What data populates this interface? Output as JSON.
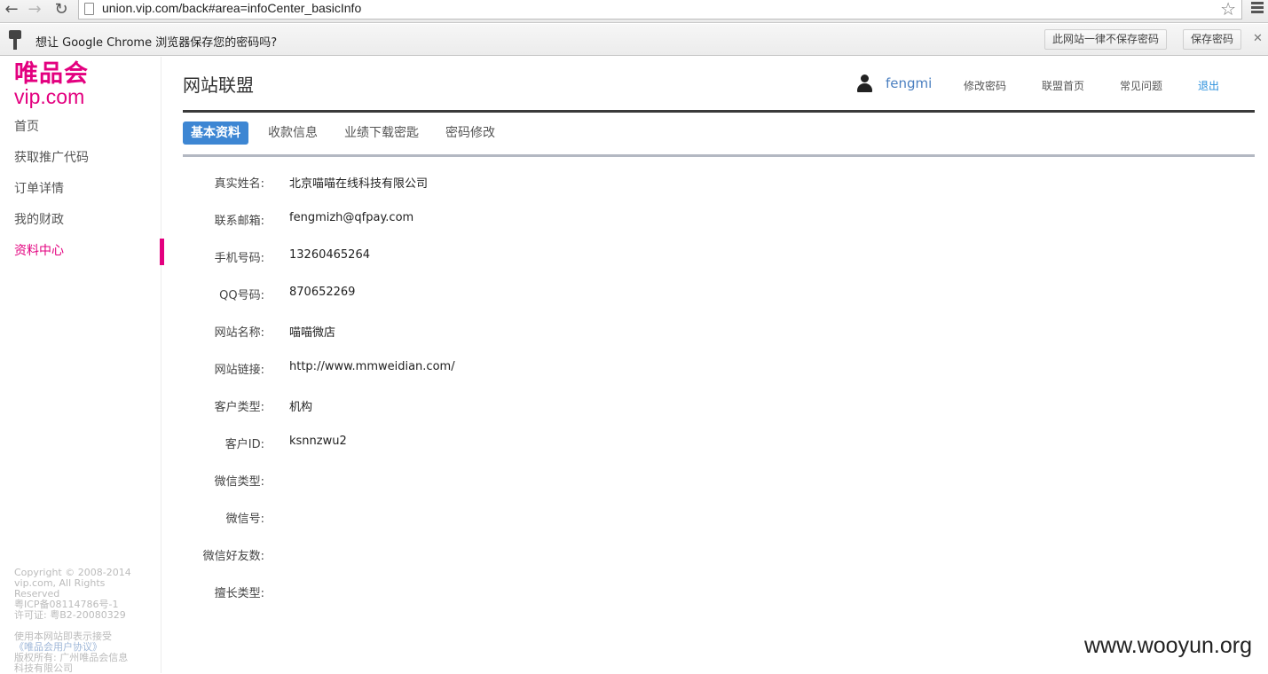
{
  "browser": {
    "url": "union.vip.com/back#area=infoCenter_basicInfo",
    "infobar_message": "想让 Google Chrome 浏览器保存您的密码吗?",
    "never_button": "此网站一律不保存密码",
    "save_button": "保存密码",
    "close_glyph": "✕",
    "back_glyph": "←",
    "forward_glyph": "→",
    "reload_glyph": "↻",
    "star_glyph": "☆",
    "icons": [
      "page-icon",
      "star-icon",
      "menu-icon",
      "key-icon"
    ]
  },
  "sidebar": {
    "logo_cn": "唯品会",
    "logo_en": "vip.com",
    "items": [
      {
        "label": "首页",
        "active": false
      },
      {
        "label": "获取推广代码",
        "active": false
      },
      {
        "label": "订单详情",
        "active": false
      },
      {
        "label": "我的财政",
        "active": false
      },
      {
        "label": "资料中心",
        "active": true
      }
    ],
    "footer": {
      "line1": "Copyright © 2008-2014",
      "line2": "vip.com, All Rights",
      "line3": "Reserved",
      "line4": "粤ICP备08114786号-1",
      "line5": "许可证: 粤B2-20080329",
      "line6": "使用本网站即表示接受",
      "line7": "《唯品会用户协议》",
      "line8": "版权所有: 广州唯品会信息",
      "line9": "科技有限公司"
    }
  },
  "header": {
    "title": "网站联盟",
    "username": "fengmi",
    "change_password": "修改密码",
    "union_home": "联盟首页",
    "faq": "常见问题",
    "logout": "退出"
  },
  "tabs": [
    {
      "label": "基本资料",
      "active": true
    },
    {
      "label": "收款信息",
      "active": false
    },
    {
      "label": "业绩下载密匙",
      "active": false
    },
    {
      "label": "密码修改",
      "active": false
    }
  ],
  "info": [
    {
      "label": "真实姓名:",
      "value": "北京喵喵在线科技有限公司"
    },
    {
      "label": "联系邮箱:",
      "value": "fengmizh@qfpay.com"
    },
    {
      "label": "手机号码:",
      "value": "13260465264"
    },
    {
      "label": "QQ号码:",
      "value": "870652269"
    },
    {
      "label": "网站名称:",
      "value": "喵喵微店"
    },
    {
      "label": "网站链接:",
      "value": "http://www.mmweidian.com/"
    },
    {
      "label": "客户类型:",
      "value": "机构"
    },
    {
      "label": "客户ID:",
      "value": "ksnnzwu2"
    },
    {
      "label": "微信类型:",
      "value": ""
    },
    {
      "label": "微信号:",
      "value": ""
    },
    {
      "label": "微信好友数:",
      "value": ""
    },
    {
      "label": "擅长类型:",
      "value": ""
    }
  ],
  "watermark": "www.wooyun.org",
  "colors": {
    "brand": "#e3007f",
    "tab_active": "#3d86d3",
    "link": "#2a8fdc"
  }
}
